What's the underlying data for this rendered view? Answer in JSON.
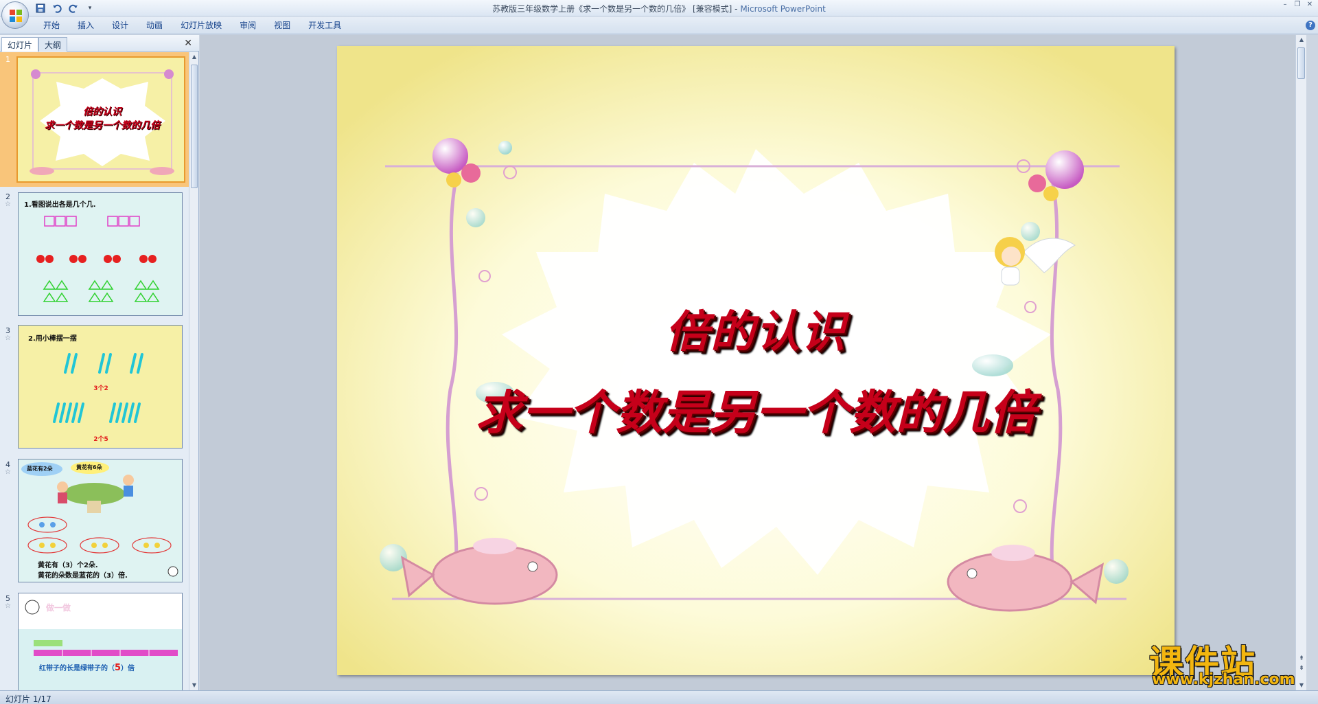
{
  "window": {
    "title": "苏教版三年级数学上册《求一个数是另一个数的几倍》 [兼容模式] - ",
    "app_name": "Microsoft PowerPoint"
  },
  "qat": {
    "save_icon": "save-icon",
    "undo_icon": "undo-icon",
    "redo_icon": "redo-icon",
    "customize": "▾"
  },
  "window_controls": {
    "minimize": "–",
    "restore": "❐",
    "close": "✕"
  },
  "ribbon": {
    "tabs": [
      "开始",
      "插入",
      "设计",
      "动画",
      "幻灯片放映",
      "审阅",
      "视图",
      "开发工具"
    ],
    "help": "?"
  },
  "left_pane": {
    "tabs": [
      "幻灯片",
      "大纲"
    ],
    "close": "✕",
    "slides": [
      {
        "num": "1",
        "title_line1": "倍的认识",
        "title_line2": "求一个数是另一个数的几倍"
      },
      {
        "num": "2",
        "caption": "1.看图说出各是几个几."
      },
      {
        "num": "3",
        "caption": "2.用小棒摆一摆",
        "label_a": "3个2",
        "label_b": "2个5"
      },
      {
        "num": "4",
        "bubble_a": "蓝花有2朵",
        "bubble_b": "黄花有6朵",
        "line1": "黄花有（3）个2朵.",
        "line2": "黄花的朵数是蓝花的（3）倍."
      },
      {
        "num": "5",
        "heading": "做一做",
        "line": "红带子的长是绿带子的（",
        "answer": "5",
        "line_end": "）倍"
      }
    ]
  },
  "slide": {
    "title_line1": "倍的认识",
    "title_line2": "求一个数是另一个数的几倍",
    "colors": {
      "background": "#f6f0a6",
      "title": "#c6001a",
      "title_shadow": "#2b0000"
    }
  },
  "watermark": {
    "text": "课件站",
    "url": "www.kjzhan.com"
  },
  "status": {
    "text": "幻灯片 1/17"
  }
}
